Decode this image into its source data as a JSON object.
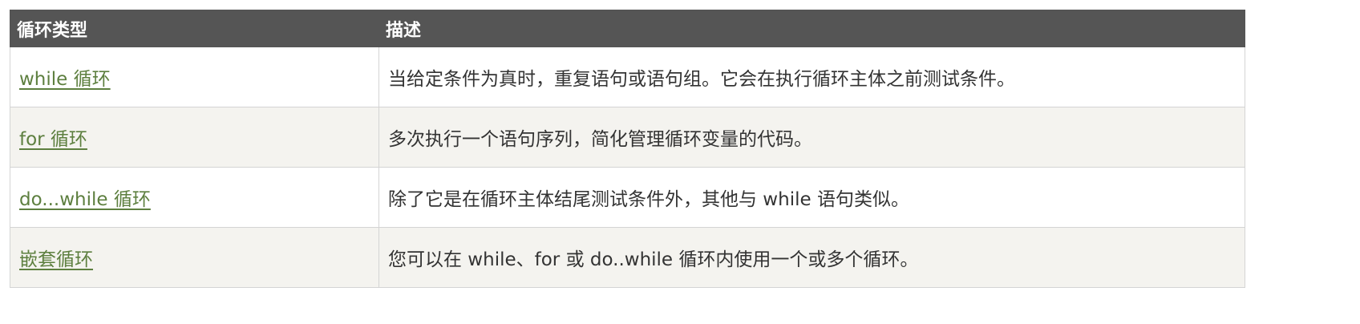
{
  "table": {
    "headers": [
      "循环类型",
      "描述"
    ],
    "rows": [
      {
        "type": "while 循环",
        "desc": "当给定条件为真时，重复语句或语句组。它会在执行循环主体之前测试条件。"
      },
      {
        "type": "for 循环",
        "desc": "多次执行一个语句序列，简化管理循环变量的代码。"
      },
      {
        "type": "do...while 循环",
        "desc": "除了它是在循环主体结尾测试条件外，其他与 while 语句类似。"
      },
      {
        "type": "嵌套循环",
        "desc": "您可以在 while、for 或 do..while 循环内使用一个或多个循环。"
      }
    ]
  },
  "colors": {
    "header_bg": "#555555",
    "header_text": "#ffffff",
    "link": "#5d7f3f",
    "row_alt_bg": "#f4f3ef",
    "border": "#d4d4d4",
    "text": "#333333"
  }
}
